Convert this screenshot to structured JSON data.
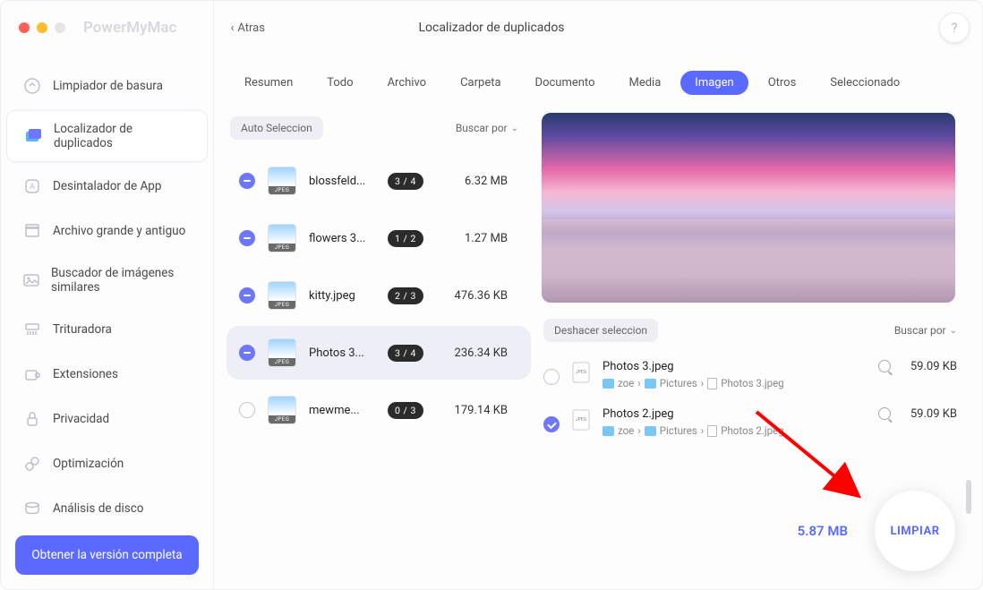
{
  "brand": "PowerMyMac",
  "back_label": "Atras",
  "title": "Localizador de duplicados",
  "help": "?",
  "sidebar": {
    "items": [
      {
        "label": "Limpiador de basura"
      },
      {
        "label": "Localizador de duplicados"
      },
      {
        "label": "Desintalador de App"
      },
      {
        "label": "Archivo grande y antiguo"
      },
      {
        "label": "Buscador de imágenes similares"
      },
      {
        "label": "Trituradora"
      },
      {
        "label": "Extensiones"
      },
      {
        "label": "Privacidad"
      },
      {
        "label": "Optimización"
      },
      {
        "label": "Análisis de disco"
      }
    ],
    "get_full": "Obtener la versión completa"
  },
  "tabs": [
    "Resumen",
    "Todo",
    "Archivo",
    "Carpeta",
    "Documento",
    "Media",
    "Imagen",
    "Otros",
    "Seleccionado"
  ],
  "active_tab": 6,
  "left": {
    "auto_select": "Auto Seleccion",
    "sort_by": "Buscar por",
    "thumb_tag": "JPEG",
    "groups": [
      {
        "name": "blossfeld...",
        "badge": "3 / 4",
        "size": "6.32 MB",
        "state": "partial"
      },
      {
        "name": "flowers 3...",
        "badge": "1 / 2",
        "size": "1.27 MB",
        "state": "partial"
      },
      {
        "name": "kitty.jpeg",
        "badge": "2 / 3",
        "size": "476.36 KB",
        "state": "partial"
      },
      {
        "name": "Photos 3...",
        "badge": "3 / 4",
        "size": "236.34 KB",
        "state": "partial",
        "selected": true
      },
      {
        "name": "mewme...",
        "badge": "0 / 3",
        "size": "179.14 KB",
        "state": "none"
      }
    ]
  },
  "right": {
    "undo": "Deshacer seleccion",
    "sort_by": "Buscar por",
    "files": [
      {
        "name": "Photos 3.jpeg",
        "path": [
          "zoe",
          "Pictures",
          "Photos 3.jpeg"
        ],
        "size": "59.09 KB",
        "checked": false
      },
      {
        "name": "Photos 2.jpeg",
        "path": [
          "zoe",
          "Pictures",
          "Photos 2.jpeg"
        ],
        "size": "59.09 KB",
        "checked": true
      }
    ],
    "path_sep": "›"
  },
  "footer": {
    "total": "5.87 MB",
    "clean": "LIMPIAR"
  }
}
